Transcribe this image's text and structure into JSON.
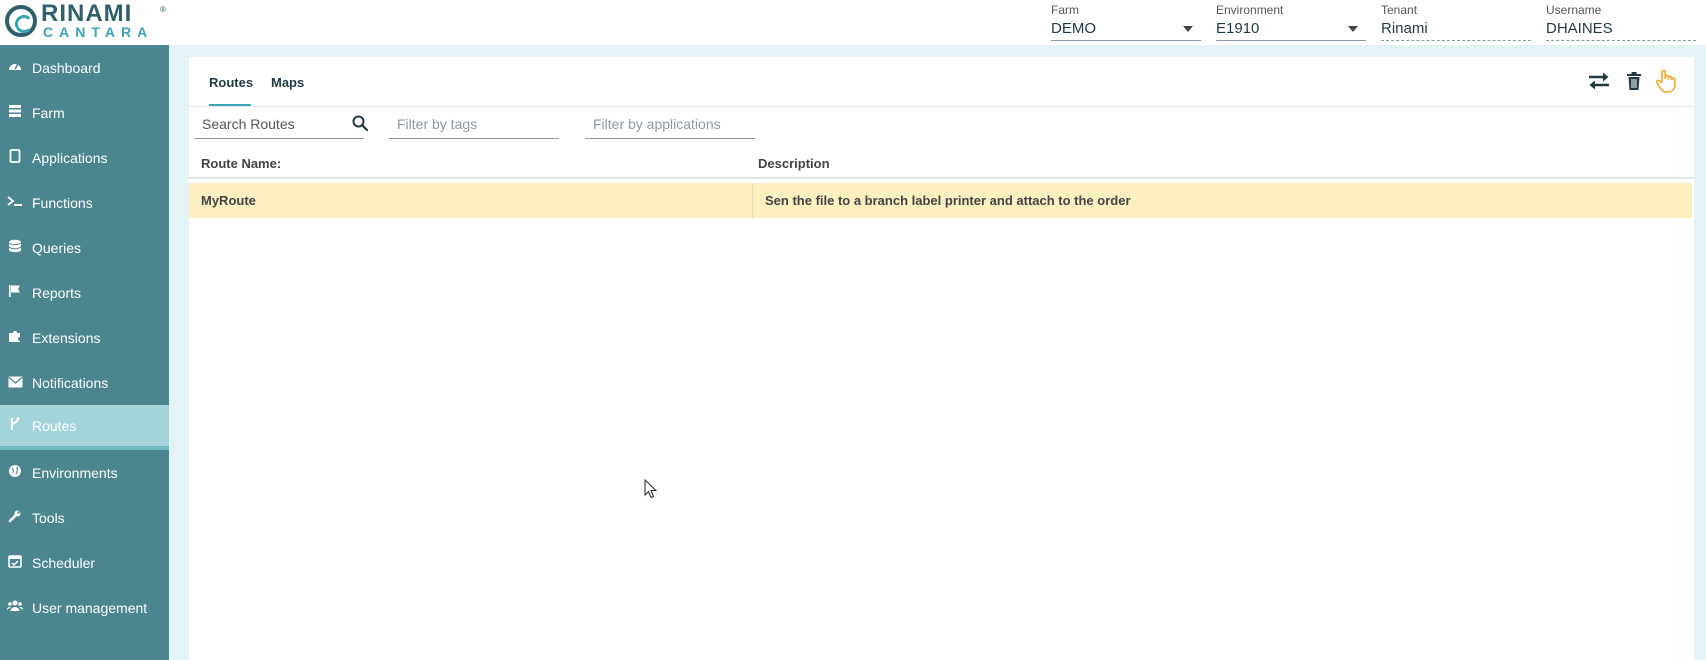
{
  "brand": {
    "top": "RINAMI",
    "bottom": "CANTARA",
    "reg": "®"
  },
  "header": {
    "farm": {
      "label": "Farm",
      "value": "DEMO"
    },
    "environment": {
      "label": "Environment",
      "value": "E1910"
    },
    "tenant": {
      "label": "Tenant",
      "value": "Rinami"
    },
    "username": {
      "label": "Username",
      "value": "DHAINES"
    }
  },
  "sidebar": {
    "items": [
      {
        "label": "Dashboard",
        "icon": "dashboard-icon"
      },
      {
        "label": "Farm",
        "icon": "server-icon"
      },
      {
        "label": "Applications",
        "icon": "tablet-icon"
      },
      {
        "label": "Functions",
        "icon": "terminal-icon"
      },
      {
        "label": "Queries",
        "icon": "database-icon"
      },
      {
        "label": "Reports",
        "icon": "flag-icon"
      },
      {
        "label": "Extensions",
        "icon": "puzzle-icon"
      },
      {
        "label": "Notifications",
        "icon": "envelope-icon"
      },
      {
        "label": "Routes",
        "icon": "branch-icon",
        "active": true
      },
      {
        "label": "Environments",
        "icon": "globe-icon"
      },
      {
        "label": "Tools",
        "icon": "wrench-icon"
      },
      {
        "label": "Scheduler",
        "icon": "calendar-check-icon"
      },
      {
        "label": "User management",
        "icon": "users-icon"
      }
    ]
  },
  "main": {
    "tabs": [
      {
        "label": "Routes",
        "active": true
      },
      {
        "label": "Maps"
      }
    ],
    "toolbar": [
      "swap-icon",
      "trash-icon",
      "pointer-hand-icon"
    ],
    "filters": {
      "search_placeholder": "Search Routes",
      "tags_placeholder": "Filter by tags",
      "applications_placeholder": "Filter by applications"
    },
    "table": {
      "columns": [
        "Route Name:",
        "Description"
      ],
      "rows": [
        {
          "name": "MyRoute",
          "description": "Sen the file to a branch label printer and attach to the order"
        }
      ]
    }
  },
  "colors": {
    "sidebar": "#4a8590",
    "sidebar_active": "#a3d4da",
    "accent": "#3aa6b3",
    "selected_row": "#fcefc0",
    "hand_icon": "#f5a623"
  }
}
